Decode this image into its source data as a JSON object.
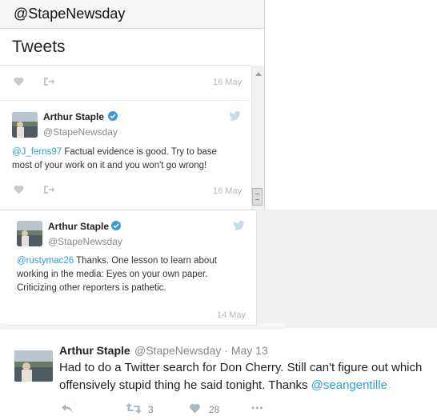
{
  "widget": {
    "handle": "@StapeNewsday",
    "title": "Tweets"
  },
  "top_partial": {
    "date": "16 May"
  },
  "tweet1": {
    "name": "Arthur Staple",
    "handle": "@StapeNewsday",
    "mention": "@J_ferns97",
    "text_line1": " Factual evidence is good. Try to base",
    "text_line2": "most of your work on it and you won't go wrong!",
    "date": "16 May"
  },
  "tweet2": {
    "name": "Arthur Staple",
    "handle": "@StapeNewsday",
    "mention": "@rustymac26",
    "text_line1": " Thanks. One lesson to learn about",
    "text_line2": "working in the media: Eyes on your own paper.",
    "text_line3": "Criticizing other reporters is pathetic.",
    "date": "14 May"
  },
  "tweet3": {
    "name": "Arthur Staple",
    "handle": "@StapeNewsday",
    "separator": "·",
    "date": "May 13",
    "text_line1": "Had to do a Twitter search for Don Cherry. Still can't figure out which",
    "text_line2": "offensively stupid thing he said tonight. Thanks ",
    "mention": "@seangentille",
    "retweets": "3",
    "likes": "28",
    "more": "•••"
  },
  "colors": {
    "link": "#2b9fd6",
    "verified": "#3a9ad9",
    "bird": "#c5dbe8",
    "action_icon": "#c9c9c9"
  }
}
